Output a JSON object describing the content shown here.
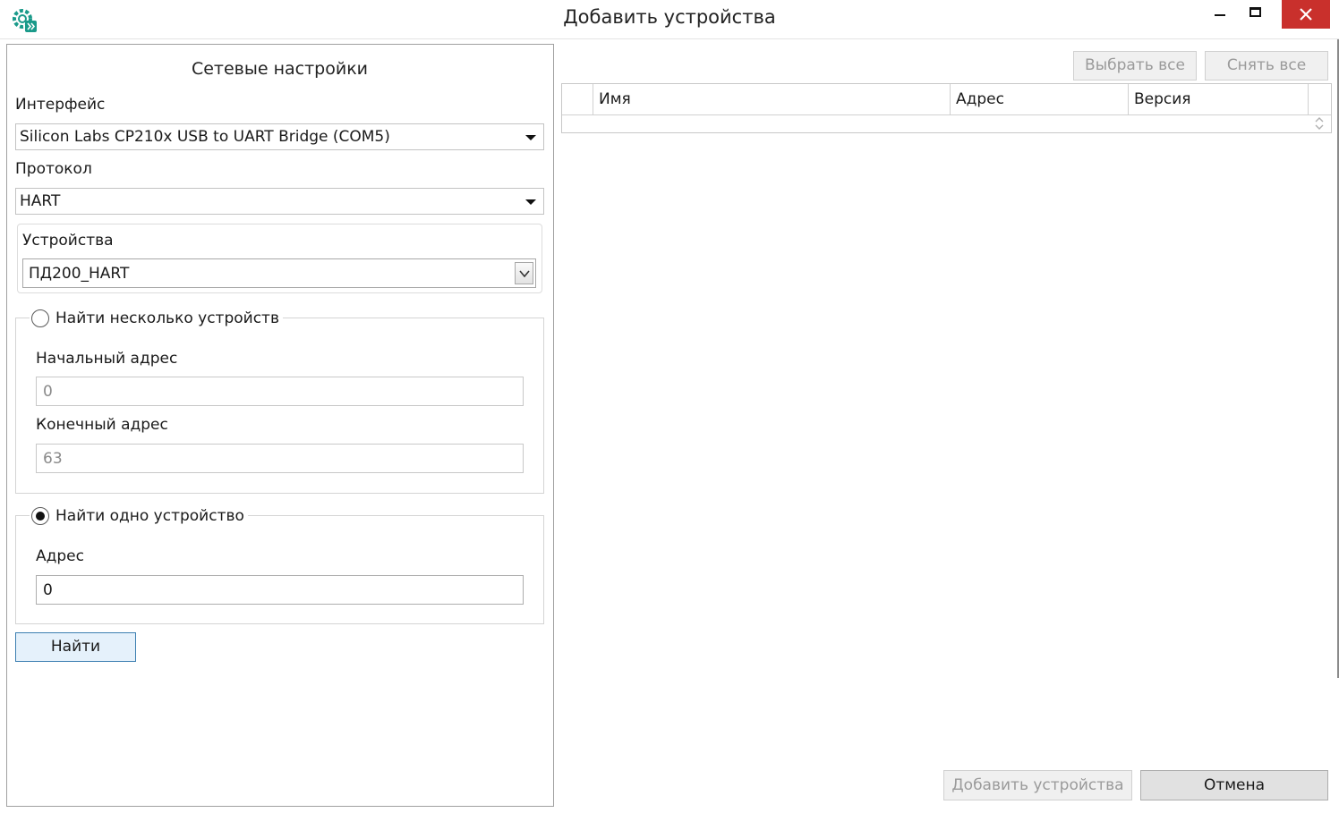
{
  "window": {
    "title": "Добавить устройства",
    "icon": "gear-devices-icon",
    "accent_color": "#1a9a8a",
    "close_color": "#c9302c"
  },
  "network_settings": {
    "title": "Сетевые настройки",
    "interface_label": "Интерфейс",
    "interface_value": "Silicon Labs CP210x USB to UART Bridge (COM5)",
    "protocol_label": "Протокол",
    "protocol_value": "HART",
    "devices_label": "Устройства",
    "device_value": "ПД200_HART"
  },
  "find_multiple": {
    "label": "Найти несколько устройств",
    "selected": false,
    "start_label": "Начальный адрес",
    "start_value": "0",
    "end_label": "Конечный адрес",
    "end_value": "63"
  },
  "find_single": {
    "label": "Найти одно устройство",
    "selected": true,
    "address_label": "Адрес",
    "address_value": "0"
  },
  "search_button": "Найти",
  "table": {
    "select_all": "Выбрать все",
    "deselect_all": "Снять все",
    "columns": [
      "Имя",
      "Адрес",
      "Версия"
    ],
    "rows": []
  },
  "footer": {
    "add_button": "Добавить устройства",
    "cancel_button": "Отмена"
  }
}
